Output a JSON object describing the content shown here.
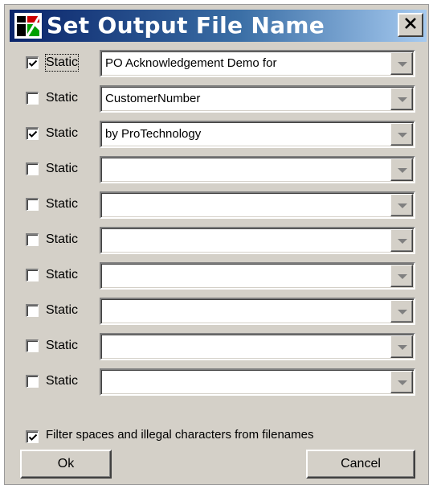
{
  "window": {
    "title": "Set Output File Name",
    "close_glyph": "✕"
  },
  "rows": [
    {
      "checked": true,
      "label": "Static",
      "value": "PO Acknowledgement Demo for",
      "focused": true
    },
    {
      "checked": false,
      "label": "Static",
      "value": "CustomerNumber"
    },
    {
      "checked": true,
      "label": "Static",
      "value": "by ProTechnology"
    },
    {
      "checked": false,
      "label": "Static",
      "value": ""
    },
    {
      "checked": false,
      "label": "Static",
      "value": ""
    },
    {
      "checked": false,
      "label": "Static",
      "value": ""
    },
    {
      "checked": false,
      "label": "Static",
      "value": ""
    },
    {
      "checked": false,
      "label": "Static",
      "value": ""
    },
    {
      "checked": false,
      "label": "Static",
      "value": ""
    },
    {
      "checked": false,
      "label": "Static",
      "value": ""
    }
  ],
  "filter": {
    "checked": true,
    "label": "Filter spaces and illegal characters from filenames"
  },
  "buttons": {
    "ok": "Ok",
    "cancel": "Cancel"
  },
  "colors": {
    "title_start": "#0a246a",
    "title_end": "#a6caf0",
    "face": "#d4d0c8"
  }
}
